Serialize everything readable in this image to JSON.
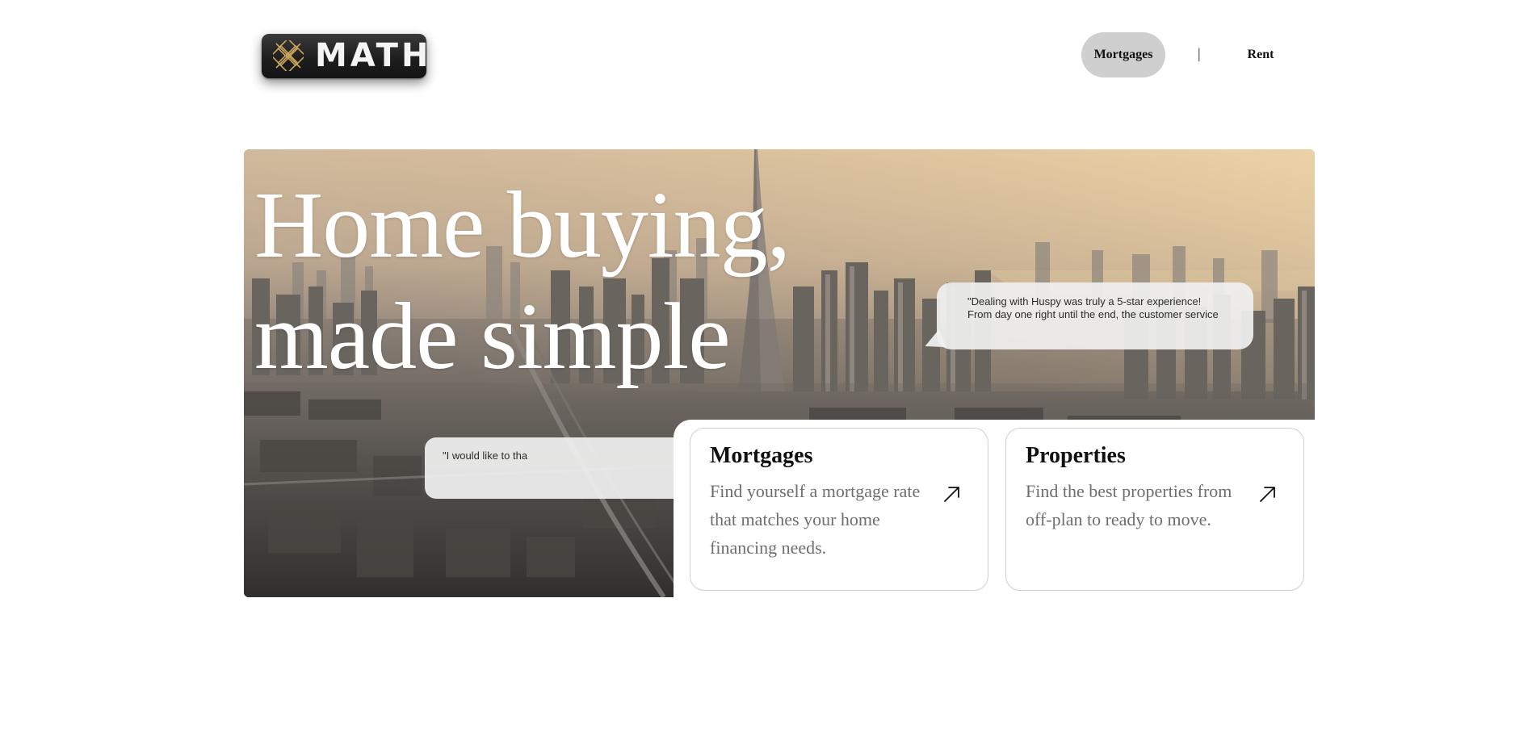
{
  "header": {
    "logo_text": "MATH",
    "nav": {
      "mortgages_label": "Mortgages",
      "separator": "|",
      "rent_label": "Rent"
    }
  },
  "hero": {
    "title_line1": "Home buying,",
    "title_line2": "made simple",
    "testimonial_1_line1": "\"Dealing with Huspy was truly a 5-star experience!",
    "testimonial_1_line2": "From day one right until the end, the customer service",
    "testimonial_2": "\"I would like to tha"
  },
  "cards": [
    {
      "title": "Mortgages",
      "description": "Find yourself a mortgage rate that matches your home financing needs.",
      "icon": "arrow-up-right-icon"
    },
    {
      "title": "Properties",
      "description": "Find the best properties from off-plan to ready to move.",
      "icon": "arrow-up-right-icon"
    }
  ],
  "colors": {
    "nav_pill_bg": "#cfcfcf",
    "logo_gold": "#c9a45a",
    "card_border": "#cfcfcf",
    "card_desc": "#6e6e6e"
  }
}
